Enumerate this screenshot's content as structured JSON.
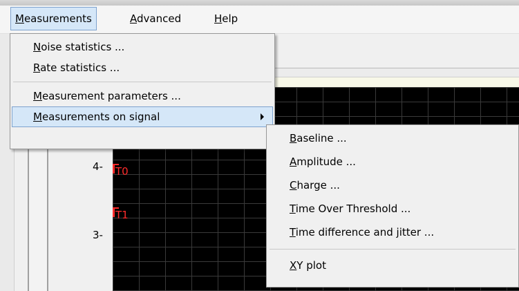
{
  "menubar": {
    "items": [
      {
        "mnemonic": "M",
        "rest": "easurements"
      },
      {
        "mnemonic": "A",
        "rest": "dvanced"
      },
      {
        "mnemonic": "H",
        "rest": "elp"
      }
    ]
  },
  "measurements_menu": {
    "items": [
      {
        "mnemonic": "N",
        "rest": "oise statistics ..."
      },
      {
        "mnemonic": "R",
        "rest": "ate statistics ..."
      },
      {
        "mnemonic": "M",
        "rest": "easurement parameters ..."
      },
      {
        "mnemonic": "M",
        "rest": "easurements on signal"
      }
    ]
  },
  "signal_submenu": {
    "items": [
      {
        "mnemonic": "B",
        "rest": "aseline ..."
      },
      {
        "mnemonic": "A",
        "rest": "mplitude ..."
      },
      {
        "mnemonic": "C",
        "rest": "harge ..."
      },
      {
        "mnemonic": "T",
        "rest": "ime Over Threshold ..."
      },
      {
        "mnemonic": "T",
        "rest": "ime difference and jitter ..."
      },
      {
        "mnemonic": "X",
        "rest": "Y plot"
      }
    ]
  },
  "plot": {
    "y_labels": [
      "4-",
      "3-"
    ],
    "markers": [
      "T0",
      "T1"
    ],
    "marker_color": "#ff2b2b",
    "background": "#000000"
  },
  "colors": {
    "highlight_fill": "#d5e7f8",
    "highlight_border": "#7da2ce",
    "menu_bg": "#f0f0f0"
  }
}
